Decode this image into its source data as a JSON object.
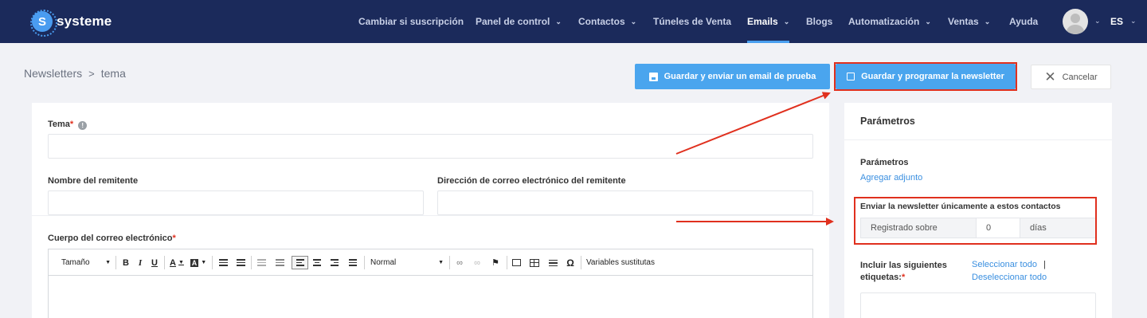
{
  "brand": {
    "name": "systeme",
    "mark": "S"
  },
  "nav": {
    "items": [
      {
        "label": "Cambiar si suscripción",
        "has_menu": false,
        "active": false
      },
      {
        "label": "Panel de control",
        "has_menu": true,
        "active": false
      },
      {
        "label": "Contactos",
        "has_menu": true,
        "active": false
      },
      {
        "label": "Túneles de Venta",
        "has_menu": false,
        "active": false
      },
      {
        "label": "Emails",
        "has_menu": true,
        "active": true
      },
      {
        "label": "Blogs",
        "has_menu": false,
        "active": false
      },
      {
        "label": "Automatización",
        "has_menu": true,
        "active": false
      },
      {
        "label": "Ventas",
        "has_menu": true,
        "active": false
      },
      {
        "label": "Ayuda",
        "has_menu": false,
        "active": false
      }
    ],
    "language": "ES"
  },
  "breadcrumb": {
    "parent": "Newsletters",
    "separator": ">",
    "current": "tema"
  },
  "actions": {
    "save_test": "Guardar y enviar un email de prueba",
    "save_schedule": "Guardar y programar la newsletter",
    "cancel": "Cancelar"
  },
  "form": {
    "subject_label": "Tema",
    "subject_info": "!",
    "subject_value": "",
    "sender_name_label": "Nombre del remitente",
    "sender_name_value": "",
    "sender_email_label": "Dirección de correo electrónico del remitente",
    "sender_email_value": "",
    "body_label": "Cuerpo del correo electrónico",
    "required_mark": "*"
  },
  "editor_toolbar": {
    "size_label": "Tamaño",
    "bold": "B",
    "italic": "I",
    "underline": "U",
    "font_color": "A",
    "bg_color": "A",
    "format_label": "Normal",
    "special_char": "Ω",
    "variables": "Variables sustitutas"
  },
  "sidebar": {
    "title": "Parámetros",
    "section_label": "Parámetros",
    "attach_link": "Agregar adjunto",
    "send_only_label": "Enviar la newsletter únicamente a estos contactos",
    "registered_label": "Registrado sobre",
    "days_value": "0",
    "days_unit": "días",
    "include_tags_label": "Incluir las siguientes etiquetas:",
    "select_all": "Seleccionar todo",
    "separator": "|",
    "deselect_all": "Deseleccionar todo"
  },
  "colors": {
    "nav_bg": "#1b2a5b",
    "accent": "#4aa5ee",
    "highlight": "#e0301e",
    "link": "#3a8fe0"
  }
}
